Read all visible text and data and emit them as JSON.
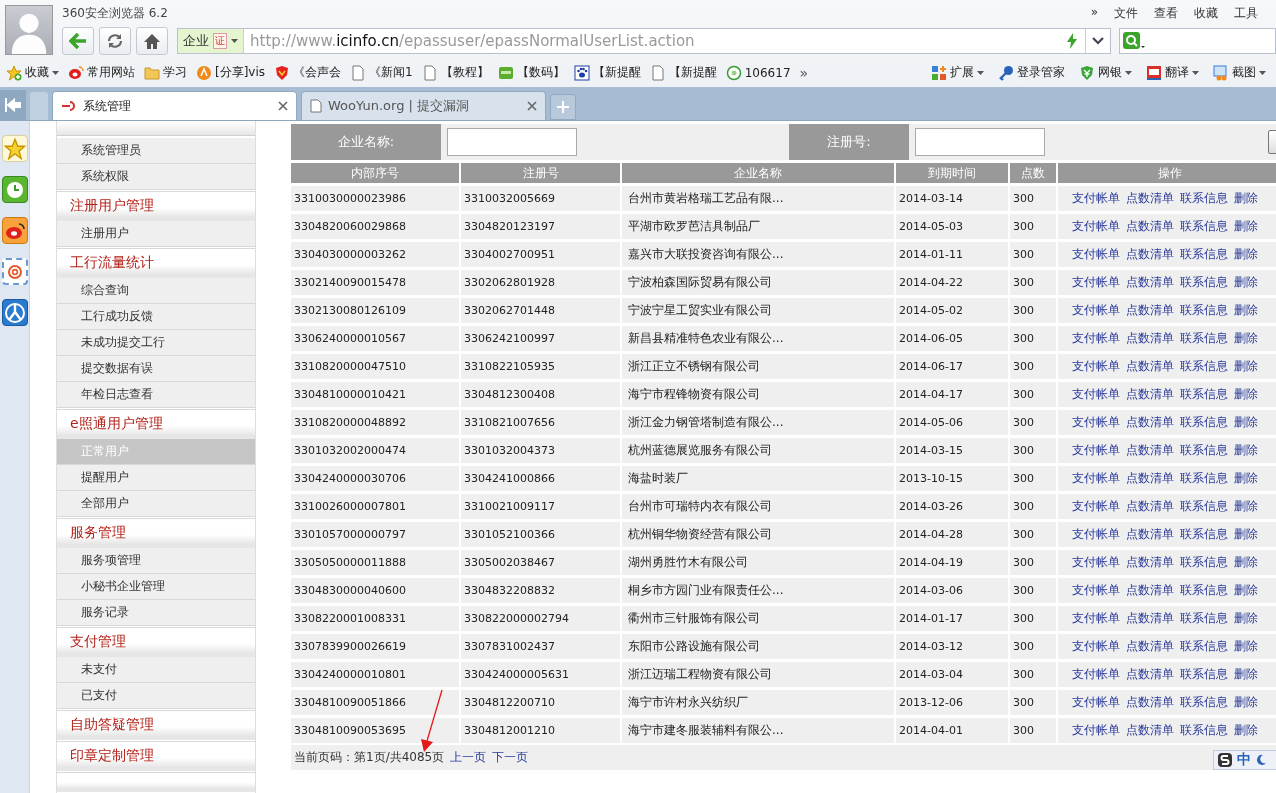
{
  "browser": {
    "title": "360安全浏览器 6.2",
    "menu": [
      "»",
      "文件",
      "查看",
      "收藏",
      "工具"
    ],
    "address": {
      "badge": "企业",
      "cert": "证",
      "url_prefix": "http://www.",
      "url_host": "icinfo.cn",
      "url_path": "/epassuser/epassNormalUserList.action"
    },
    "bookmarks": [
      {
        "label": "收藏",
        "dropdown": true
      },
      {
        "label": "常用网站",
        "dropdown": false
      },
      {
        "label": "学习",
        "dropdown": false
      },
      {
        "label": "[分享]vis",
        "dropdown": false
      },
      {
        "label": "《会声会",
        "dropdown": false
      },
      {
        "label": "《新闻1",
        "dropdown": false
      },
      {
        "label": "【教程】",
        "dropdown": false
      },
      {
        "label": "【数码】",
        "dropdown": false
      },
      {
        "label": "【新提醒",
        "dropdown": false
      },
      {
        "label": "【新提醒",
        "dropdown": false
      },
      {
        "label": "106617",
        "dropdown": false
      }
    ],
    "bookmarks_more": "»",
    "tools": [
      {
        "label": "扩展",
        "dropdown": true
      },
      {
        "label": "登录管家",
        "dropdown": false
      },
      {
        "label": "网银",
        "dropdown": true
      },
      {
        "label": "翻译",
        "dropdown": true
      },
      {
        "label": "截图",
        "dropdown": true
      }
    ],
    "tabs": [
      {
        "label": "系统管理",
        "selected": true
      },
      {
        "label": "WooYun.org | 提交漏洞",
        "selected": false
      }
    ]
  },
  "sidebar": {
    "groups": [
      {
        "items": [
          {
            "label": "系统管理员",
            "selected": false
          },
          {
            "label": "系统权限",
            "selected": false
          }
        ]
      },
      {
        "heading": "注册用户管理",
        "items": [
          {
            "label": "注册用户",
            "selected": false
          }
        ]
      },
      {
        "heading": "工行流量统计",
        "items": [
          {
            "label": "综合查询",
            "selected": false
          },
          {
            "label": "工行成功反馈",
            "selected": false
          },
          {
            "label": "未成功提交工行",
            "selected": false
          },
          {
            "label": "提交数据有误",
            "selected": false
          },
          {
            "label": "年检日志查看",
            "selected": false
          }
        ]
      },
      {
        "heading": "e照通用户管理",
        "items": [
          {
            "label": "正常用户",
            "selected": true
          },
          {
            "label": "提醒用户",
            "selected": false
          },
          {
            "label": "全部用户",
            "selected": false
          }
        ]
      },
      {
        "heading": "服务管理",
        "items": [
          {
            "label": "服务项管理",
            "selected": false
          },
          {
            "label": "小秘书企业管理",
            "selected": false
          },
          {
            "label": "服务记录",
            "selected": false
          }
        ]
      },
      {
        "heading": "支付管理",
        "items": [
          {
            "label": "未支付",
            "selected": false
          },
          {
            "label": "已支付",
            "selected": false
          }
        ]
      },
      {
        "heading": "自助答疑管理"
      },
      {
        "heading": "印章定制管理"
      }
    ]
  },
  "search": {
    "fields": [
      {
        "label": "企业名称:"
      },
      {
        "label": "注册号:"
      }
    ]
  },
  "table": {
    "columns": [
      "内部序号",
      "注册号",
      "企业名称",
      "到期时间",
      "点数",
      "操作"
    ],
    "rows": [
      {
        "cells": [
          "3310030000023986",
          "3310032005669",
          "台州市黄岩格瑞工艺品有限...",
          "2014-03-14",
          "300"
        ],
        "actions": [
          "支付帐单",
          "点数清单",
          "联系信息",
          "删除"
        ]
      },
      {
        "cells": [
          "3304820060029868",
          "3304820123197",
          "平湖市欧罗芭洁具制品厂",
          "2014-05-03",
          "300"
        ],
        "actions": [
          "支付帐单",
          "点数清单",
          "联系信息",
          "删除"
        ]
      },
      {
        "cells": [
          "3304030000003262",
          "3304002700951",
          "嘉兴市大联投资咨询有限公...",
          "2014-01-11",
          "300"
        ],
        "actions": [
          "支付帐单",
          "点数清单",
          "联系信息",
          "删除"
        ]
      },
      {
        "cells": [
          "3302140090015478",
          "3302062801928",
          "宁波柏森国际贸易有限公司",
          "2014-04-22",
          "300"
        ],
        "actions": [
          "支付帐单",
          "点数清单",
          "联系信息",
          "删除"
        ]
      },
      {
        "cells": [
          "3302130080126109",
          "3302062701448",
          "宁波宁星工贸实业有限公司",
          "2014-05-02",
          "300"
        ],
        "actions": [
          "支付帐单",
          "点数清单",
          "联系信息",
          "删除"
        ]
      },
      {
        "cells": [
          "3306240000010567",
          "3306242100997",
          "新昌县精准特色农业有限公...",
          "2014-06-05",
          "300"
        ],
        "actions": [
          "支付帐单",
          "点数清单",
          "联系信息",
          "删除"
        ]
      },
      {
        "cells": [
          "3310820000047510",
          "3310822105935",
          "浙江正立不锈钢有限公司",
          "2014-06-17",
          "300"
        ],
        "actions": [
          "支付帐单",
          "点数清单",
          "联系信息",
          "删除"
        ]
      },
      {
        "cells": [
          "3304810000010421",
          "3304812300408",
          "海宁市程锋物资有限公司",
          "2014-04-17",
          "300"
        ],
        "actions": [
          "支付帐单",
          "点数清单",
          "联系信息",
          "删除"
        ]
      },
      {
        "cells": [
          "3310820000048892",
          "3310821007656",
          "浙江金力钢管塔制造有限公...",
          "2014-05-06",
          "300"
        ],
        "actions": [
          "支付帐单",
          "点数清单",
          "联系信息",
          "删除"
        ]
      },
      {
        "cells": [
          "3301032002000474",
          "3301032004373",
          "杭州蓝德展览服务有限公司",
          "2014-03-15",
          "300"
        ],
        "actions": [
          "支付帐单",
          "点数清单",
          "联系信息",
          "删除"
        ]
      },
      {
        "cells": [
          "3304240000030706",
          "3304241000866",
          "海盐时装厂",
          "2013-10-15",
          "300"
        ],
        "actions": [
          "支付帐单",
          "点数清单",
          "联系信息",
          "删除"
        ]
      },
      {
        "cells": [
          "3310026000007801",
          "3310021009117",
          "台州市可瑞特内衣有限公司",
          "2014-03-26",
          "300"
        ],
        "actions": [
          "支付帐单",
          "点数清单",
          "联系信息",
          "删除"
        ]
      },
      {
        "cells": [
          "3301057000000797",
          "3301052100366",
          "杭州铜华物资经营有限公司",
          "2014-04-28",
          "300"
        ],
        "actions": [
          "支付帐单",
          "点数清单",
          "联系信息",
          "删除"
        ]
      },
      {
        "cells": [
          "3305050000011888",
          "3305002038467",
          "湖州勇胜竹木有限公司",
          "2014-04-19",
          "300"
        ],
        "actions": [
          "支付帐单",
          "点数清单",
          "联系信息",
          "删除"
        ]
      },
      {
        "cells": [
          "3304830000040600",
          "3304832208832",
          "桐乡市方园门业有限责任公...",
          "2014-03-06",
          "300"
        ],
        "actions": [
          "支付帐单",
          "点数清单",
          "联系信息",
          "删除"
        ]
      },
      {
        "cells": [
          "3308220001008331",
          "330822000002794",
          "衢州市三针服饰有限公司",
          "2014-01-17",
          "300"
        ],
        "actions": [
          "支付帐单",
          "点数清单",
          "联系信息",
          "删除"
        ]
      },
      {
        "cells": [
          "3307839900026619",
          "3307831002437",
          "东阳市公路设施有限公司",
          "2014-03-12",
          "300"
        ],
        "actions": [
          "支付帐单",
          "点数清单",
          "联系信息",
          "删除"
        ]
      },
      {
        "cells": [
          "3304240000010801",
          "330424000005631",
          "浙江迈瑞工程物资有限公司",
          "2014-03-04",
          "300"
        ],
        "actions": [
          "支付帐单",
          "点数清单",
          "联系信息",
          "删除"
        ]
      },
      {
        "cells": [
          "3304810090051866",
          "3304812200710",
          "海宁市许村永兴纺织厂",
          "2013-12-06",
          "300"
        ],
        "actions": [
          "支付帐单",
          "点数清单",
          "联系信息",
          "删除"
        ]
      },
      {
        "cells": [
          "3304810090053695",
          "3304812001210",
          "海宁市建冬服装辅料有限公...",
          "2014-04-01",
          "300"
        ],
        "actions": [
          "支付帐单",
          "点数清单",
          "联系信息",
          "删除"
        ]
      }
    ]
  },
  "pagination": {
    "text": "当前页码：第1页/共4085页",
    "links": [
      "上一页",
      "下一页"
    ]
  },
  "ime": {
    "mode": "中"
  }
}
